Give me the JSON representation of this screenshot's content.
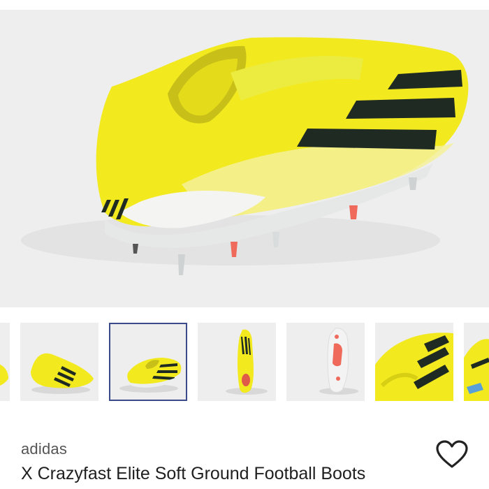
{
  "product": {
    "brand": "adidas",
    "title": "X Crazyfast Elite Soft Ground Football Boots"
  },
  "gallery": {
    "selected_index": 2,
    "thumbnails": [
      {
        "view": "partial-side"
      },
      {
        "view": "side"
      },
      {
        "view": "rear-angle"
      },
      {
        "view": "top"
      },
      {
        "view": "sole"
      },
      {
        "view": "detail-closeup"
      },
      {
        "view": "partial-detail"
      }
    ]
  },
  "icons": {
    "wishlist": "heart-outline-icon"
  },
  "colors": {
    "boot_yellow": "#f2ea1e",
    "stripe": "#1f2a22",
    "sole_white": "#eceeee",
    "stud_red": "#ef6a5a",
    "selected_border": "#3a4a8a",
    "background": "#eeeeee"
  }
}
